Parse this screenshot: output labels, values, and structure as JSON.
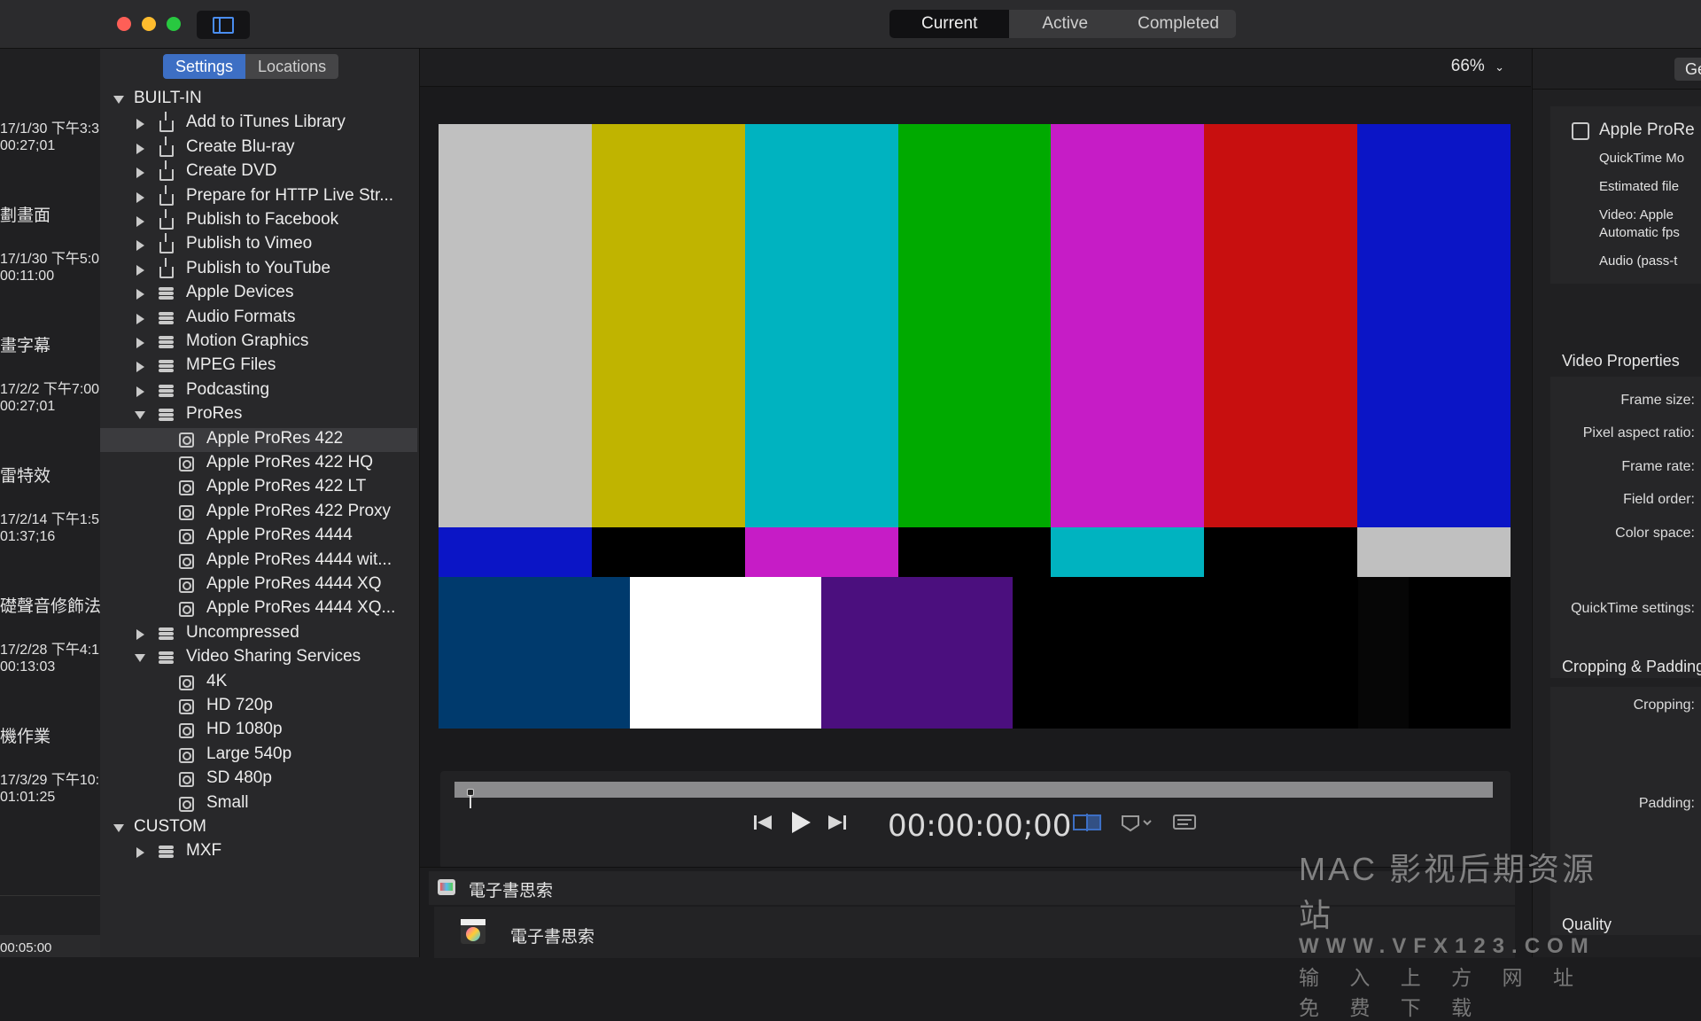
{
  "window": {
    "tabs": [
      "Current",
      "Active",
      "Completed"
    ],
    "selected_tab": "Current"
  },
  "history": [
    {
      "date": "17/1/30 下午3:3",
      "duration": "00:27;01"
    },
    {
      "title": "劃畫面",
      "date": "17/1/30 下午5:0",
      "duration": "00:11:00"
    },
    {
      "title": "畫字幕",
      "date": "17/2/2 下午7:00",
      "duration": "00:27;01"
    },
    {
      "title": "雷特效",
      "date": "17/2/14 下午1:5",
      "duration": "01:37;16"
    },
    {
      "title": "礎聲音修飾法",
      "date": "17/2/28 下午4:1",
      "duration": "00:13:03"
    },
    {
      "title": "機作業",
      "date": "17/3/29 下午10:",
      "duration": "01:01:25"
    },
    {
      "duration": "00:05:00"
    }
  ],
  "settings": {
    "tabs": [
      "Settings",
      "Locations"
    ],
    "selected_tab": "Settings",
    "tree": [
      {
        "label": "BUILT-IN",
        "level": 0,
        "disc": "down",
        "icon": "none"
      },
      {
        "label": "Add to iTunes Library",
        "level": 1,
        "disc": "right",
        "icon": "share-icon"
      },
      {
        "label": "Create Blu-ray",
        "level": 1,
        "disc": "right",
        "icon": "share-icon"
      },
      {
        "label": "Create DVD",
        "level": 1,
        "disc": "right",
        "icon": "share-icon"
      },
      {
        "label": "Prepare for HTTP Live Str...",
        "level": 1,
        "disc": "right",
        "icon": "share-icon"
      },
      {
        "label": "Publish to Facebook",
        "level": 1,
        "disc": "right",
        "icon": "share-icon"
      },
      {
        "label": "Publish to Vimeo",
        "level": 1,
        "disc": "right",
        "icon": "share-icon"
      },
      {
        "label": "Publish to YouTube",
        "level": 1,
        "disc": "right",
        "icon": "share-icon"
      },
      {
        "label": "Apple Devices",
        "level": 1,
        "disc": "right",
        "icon": "group-icon"
      },
      {
        "label": "Audio Formats",
        "level": 1,
        "disc": "right",
        "icon": "group-icon"
      },
      {
        "label": "Motion Graphics",
        "level": 1,
        "disc": "right",
        "icon": "group-icon"
      },
      {
        "label": "MPEG Files",
        "level": 1,
        "disc": "right",
        "icon": "group-icon"
      },
      {
        "label": "Podcasting",
        "level": 1,
        "disc": "right",
        "icon": "group-icon"
      },
      {
        "label": "ProRes",
        "level": 1,
        "disc": "down",
        "icon": "group-icon"
      },
      {
        "label": "Apple ProRes 422",
        "level": 2,
        "disc": "none",
        "icon": "quicktime-icon",
        "selected": true
      },
      {
        "label": "Apple ProRes 422 HQ",
        "level": 2,
        "disc": "none",
        "icon": "quicktime-icon"
      },
      {
        "label": "Apple ProRes 422 LT",
        "level": 2,
        "disc": "none",
        "icon": "quicktime-icon"
      },
      {
        "label": "Apple ProRes 422 Proxy",
        "level": 2,
        "disc": "none",
        "icon": "quicktime-icon"
      },
      {
        "label": "Apple ProRes 4444",
        "level": 2,
        "disc": "none",
        "icon": "quicktime-icon"
      },
      {
        "label": "Apple ProRes 4444 wit...",
        "level": 2,
        "disc": "none",
        "icon": "quicktime-icon"
      },
      {
        "label": "Apple ProRes 4444 XQ",
        "level": 2,
        "disc": "none",
        "icon": "quicktime-icon"
      },
      {
        "label": "Apple ProRes 4444 XQ...",
        "level": 2,
        "disc": "none",
        "icon": "quicktime-icon"
      },
      {
        "label": "Uncompressed",
        "level": 1,
        "disc": "right",
        "icon": "group-icon"
      },
      {
        "label": "Video Sharing Services",
        "level": 1,
        "disc": "down",
        "icon": "group-icon"
      },
      {
        "label": "4K",
        "level": 2,
        "disc": "none",
        "icon": "quicktime-icon"
      },
      {
        "label": "HD 720p",
        "level": 2,
        "disc": "none",
        "icon": "quicktime-icon"
      },
      {
        "label": "HD 1080p",
        "level": 2,
        "disc": "none",
        "icon": "quicktime-icon"
      },
      {
        "label": "Large 540p",
        "level": 2,
        "disc": "none",
        "icon": "quicktime-icon"
      },
      {
        "label": "SD 480p",
        "level": 2,
        "disc": "none",
        "icon": "quicktime-icon"
      },
      {
        "label": "Small",
        "level": 2,
        "disc": "none",
        "icon": "quicktime-icon"
      },
      {
        "label": "CUSTOM",
        "level": 0,
        "disc": "down",
        "icon": "none"
      },
      {
        "label": "MXF",
        "level": 1,
        "disc": "right",
        "icon": "group-icon"
      }
    ]
  },
  "viewer": {
    "zoom": "66%",
    "timecode": "00:00:00;00",
    "playhead_fraction": 0,
    "color_bars": {
      "top": [
        "#c0c0c0",
        "#c0b400",
        "#00b3c0",
        "#00aa00",
        "#c61cc6",
        "#c80f0f",
        "#0b15c6"
      ],
      "middle": [
        "#0b15c6",
        "#000000",
        "#c61cc6",
        "#000000",
        "#00b3c0",
        "#000000",
        "#c0c0c0"
      ],
      "bottom": [
        "#003a6d",
        "#ffffff",
        "#4b0f7e",
        "#000000",
        "#000000",
        "#060606",
        "#000000"
      ]
    }
  },
  "batch": {
    "header_title": "電子書思索",
    "item_title": "電子書思索"
  },
  "inspector": {
    "header_button": "Ge",
    "preset_name": "Apple ProRe",
    "summary_lines": [
      "QuickTime Mo",
      "Estimated file",
      "Video: Apple",
      "Automatic fps",
      "Audio (pass-t"
    ],
    "video_properties_title": "Video Properties",
    "video_labels": [
      "Frame size:",
      "Pixel aspect ratio:",
      "Frame rate:",
      "Field order:",
      "Color space:",
      "QuickTime settings:"
    ],
    "cropping_title": "Cropping & Padding",
    "cropping_labels": [
      "Cropping:",
      "Padding:"
    ],
    "quality_title": "Quality"
  },
  "watermark": {
    "line1": "MAC 影视后期资源站",
    "line2": "WWW.VFX123.COM",
    "line3": "输 入 上 方 网 址   免 费 下 载"
  },
  "colors": {
    "accent": "#3d6fc4",
    "traffic_red": "#fe5f57",
    "traffic_yellow": "#febc2e",
    "traffic_green": "#28c840"
  }
}
